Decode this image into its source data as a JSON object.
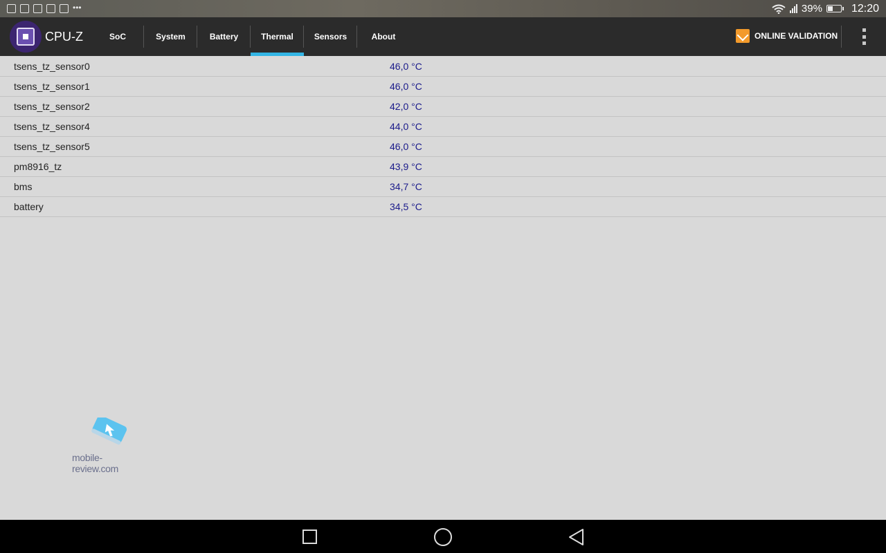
{
  "status_bar": {
    "notification_icons": [
      "image-icon",
      "mail-icon",
      "check-icon",
      "check-icon",
      "check-icon"
    ],
    "overflow": "•••",
    "battery_percent": "39%",
    "time": "12:20"
  },
  "app": {
    "title": "CPU-Z",
    "tabs": [
      {
        "label": "SoC"
      },
      {
        "label": "System"
      },
      {
        "label": "Battery"
      },
      {
        "label": "Thermal"
      },
      {
        "label": "Sensors"
      },
      {
        "label": "About"
      }
    ],
    "active_tab": "Thermal",
    "online_validation_label": "ONLINE VALIDATION"
  },
  "sensors": [
    {
      "name": "tsens_tz_sensor0",
      "value": "46,0 °C"
    },
    {
      "name": "tsens_tz_sensor1",
      "value": "46,0 °C"
    },
    {
      "name": "tsens_tz_sensor2",
      "value": "42,0 °C"
    },
    {
      "name": "tsens_tz_sensor4",
      "value": "44,0 °C"
    },
    {
      "name": "tsens_tz_sensor5",
      "value": "46,0 °C"
    },
    {
      "name": "pm8916_tz",
      "value": "43,9 °C"
    },
    {
      "name": "bms",
      "value": "34,7 °C"
    },
    {
      "name": "battery",
      "value": "34,5 °C"
    }
  ],
  "watermark": {
    "text": "mobile-review.com"
  },
  "colors": {
    "accent": "#33b5e5",
    "app_bar": "#2b2b2b",
    "value_text": "#1a1a8a",
    "background": "#d9d9d9"
  }
}
